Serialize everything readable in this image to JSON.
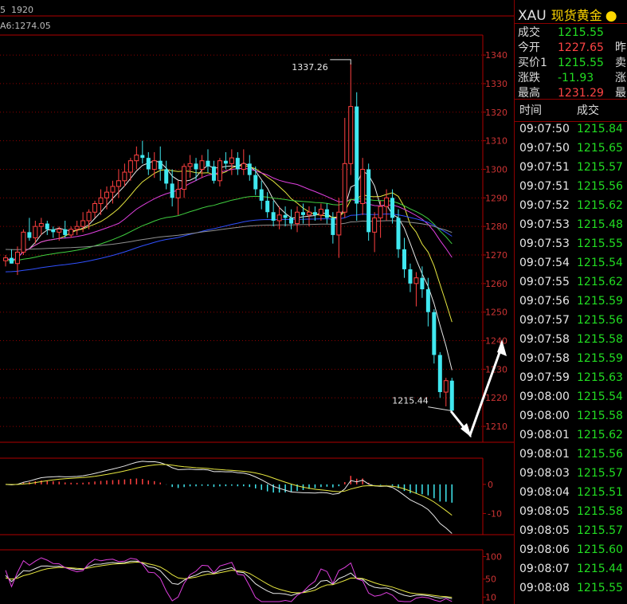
{
  "header": {
    "period": "5",
    "count": "1920",
    "ma_text": "A6:1274.05"
  },
  "chart_data": [
    {
      "type": "candlestick",
      "yticks": [
        1210,
        1220,
        1230,
        1240,
        1250,
        1260,
        1270,
        1280,
        1290,
        1300,
        1310,
        1320,
        1330,
        1340
      ],
      "ylim": [
        1205,
        1347
      ],
      "annotations": [
        {
          "label": "1337.26",
          "value": 1337.26
        },
        {
          "label": "1215.44",
          "value": 1215.44
        }
      ],
      "candles": [
        [
          1268,
          1270,
          1266,
          1269
        ],
        [
          1269,
          1272,
          1267,
          1267
        ],
        [
          1267,
          1273,
          1263,
          1271
        ],
        [
          1271,
          1279,
          1270,
          1278
        ],
        [
          1278,
          1283,
          1275,
          1276
        ],
        [
          1276,
          1282,
          1274,
          1280
        ],
        [
          1280,
          1283,
          1277,
          1281
        ],
        [
          1281,
          1282,
          1277,
          1279
        ],
        [
          1279,
          1280,
          1276,
          1278
        ],
        [
          1278,
          1280,
          1275,
          1279
        ],
        [
          1279,
          1282,
          1276,
          1277
        ],
        [
          1277,
          1280,
          1276,
          1279
        ],
        [
          1279,
          1282,
          1277,
          1280
        ],
        [
          1280,
          1285,
          1278,
          1282
        ],
        [
          1282,
          1286,
          1279,
          1285
        ],
        [
          1285,
          1289,
          1283,
          1288
        ],
        [
          1288,
          1293,
          1284,
          1290
        ],
        [
          1290,
          1294,
          1286,
          1292
        ],
        [
          1292,
          1296,
          1288,
          1294
        ],
        [
          1294,
          1300,
          1290,
          1296
        ],
        [
          1296,
          1302,
          1294,
          1299
        ],
        [
          1299,
          1304,
          1296,
          1303
        ],
        [
          1303,
          1308,
          1300,
          1305
        ],
        [
          1305,
          1310,
          1302,
          1304
        ],
        [
          1304,
          1306,
          1298,
          1300
        ],
        [
          1300,
          1306,
          1297,
          1303
        ],
        [
          1303,
          1308,
          1296,
          1300
        ],
        [
          1300,
          1303,
          1293,
          1295
        ],
        [
          1295,
          1300,
          1287,
          1290
        ],
        [
          1290,
          1296,
          1284,
          1293
        ],
        [
          1293,
          1302,
          1290,
          1301
        ],
        [
          1301,
          1305,
          1297,
          1302
        ],
        [
          1302,
          1304,
          1296,
          1300
        ],
        [
          1300,
          1305,
          1297,
          1303
        ],
        [
          1303,
          1307,
          1299,
          1301
        ],
        [
          1301,
          1303,
          1295,
          1296
        ],
        [
          1296,
          1304,
          1294,
          1303
        ],
        [
          1303,
          1306,
          1300,
          1302
        ],
        [
          1302,
          1307,
          1298,
          1304
        ],
        [
          1304,
          1306,
          1298,
          1300
        ],
        [
          1300,
          1307,
          1298,
          1302
        ],
        [
          1302,
          1305,
          1296,
          1298
        ],
        [
          1298,
          1301,
          1291,
          1293
        ],
        [
          1293,
          1296,
          1286,
          1289
        ],
        [
          1289,
          1292,
          1283,
          1285
        ],
        [
          1285,
          1289,
          1280,
          1282
        ],
        [
          1282,
          1287,
          1279,
          1284
        ],
        [
          1284,
          1287,
          1280,
          1283
        ],
        [
          1283,
          1286,
          1279,
          1281
        ],
        [
          1281,
          1287,
          1278,
          1285
        ],
        [
          1285,
          1288,
          1281,
          1284
        ],
        [
          1284,
          1287,
          1280,
          1285
        ],
        [
          1285,
          1287,
          1282,
          1284
        ],
        [
          1284,
          1288,
          1282,
          1286
        ],
        [
          1286,
          1288,
          1281,
          1283
        ],
        [
          1283,
          1285,
          1274,
          1277
        ],
        [
          1277,
          1290,
          1269,
          1285
        ],
        [
          1285,
          1318,
          1283,
          1302
        ],
        [
          1302,
          1337.26,
          1298,
          1322
        ],
        [
          1322,
          1327,
          1282,
          1288
        ],
        [
          1288,
          1304,
          1284,
          1300
        ],
        [
          1300,
          1302,
          1275,
          1278
        ],
        [
          1278,
          1285,
          1271,
          1283
        ],
        [
          1283,
          1289,
          1276,
          1287
        ],
        [
          1287,
          1293,
          1282,
          1290
        ],
        [
          1290,
          1293,
          1281,
          1283
        ],
        [
          1283,
          1286,
          1269,
          1272
        ],
        [
          1272,
          1276,
          1262,
          1265
        ],
        [
          1265,
          1267,
          1257,
          1260
        ],
        [
          1260,
          1264,
          1252,
          1262
        ],
        [
          1262,
          1266,
          1255,
          1258
        ],
        [
          1258,
          1262,
          1245,
          1250
        ],
        [
          1250,
          1251,
          1232,
          1235
        ],
        [
          1235,
          1236,
          1220,
          1222
        ],
        [
          1222,
          1227,
          1217,
          1226
        ],
        [
          1226,
          1227,
          1215.44,
          1215.5
        ]
      ]
    },
    {
      "type": "macd",
      "yticks": [
        0,
        -10
      ],
      "ylim": [
        -17,
        9
      ]
    },
    {
      "type": "oscillator",
      "yticks": [
        100,
        50,
        10
      ],
      "ylim": [
        0,
        115
      ]
    }
  ],
  "quote": {
    "symbol": "XAU",
    "name": "现货黄金",
    "dot": "●",
    "rows": [
      {
        "label": "成交",
        "value": "1215.55",
        "color": "#22dd22",
        "extra": ""
      },
      {
        "label": "今开",
        "value": "1227.65",
        "color": "#ff4444",
        "extra": "昨"
      },
      {
        "label": "买价1",
        "value": "1215.55",
        "color": "#22dd22",
        "extra": "卖"
      },
      {
        "label": "涨跌",
        "value": "-11.93",
        "color": "#22dd22",
        "extra": "涨"
      },
      {
        "label": "最高",
        "value": "1231.29",
        "color": "#ff4444",
        "extra": "最"
      }
    ]
  },
  "ticks": {
    "col_time": "时间",
    "col_price": "成交",
    "rows": [
      {
        "time": "09:07:50",
        "price": "1215.84"
      },
      {
        "time": "09:07:50",
        "price": "1215.65"
      },
      {
        "time": "09:07:51",
        "price": "1215.57"
      },
      {
        "time": "09:07:51",
        "price": "1215.56"
      },
      {
        "time": "09:07:52",
        "price": "1215.62"
      },
      {
        "time": "09:07:53",
        "price": "1215.48"
      },
      {
        "time": "09:07:53",
        "price": "1215.55"
      },
      {
        "time": "09:07:54",
        "price": "1215.54"
      },
      {
        "time": "09:07:55",
        "price": "1215.62"
      },
      {
        "time": "09:07:56",
        "price": "1215.59"
      },
      {
        "time": "09:07:57",
        "price": "1215.56"
      },
      {
        "time": "09:07:58",
        "price": "1215.58"
      },
      {
        "time": "09:07:58",
        "price": "1215.59"
      },
      {
        "time": "09:07:59",
        "price": "1215.63"
      },
      {
        "time": "09:08:00",
        "price": "1215.54"
      },
      {
        "time": "09:08:00",
        "price": "1215.58"
      },
      {
        "time": "09:08:01",
        "price": "1215.62"
      },
      {
        "time": "09:08:01",
        "price": "1215.56"
      },
      {
        "time": "09:08:03",
        "price": "1215.57"
      },
      {
        "time": "09:08:04",
        "price": "1215.51"
      },
      {
        "time": "09:08:05",
        "price": "1215.58"
      },
      {
        "time": "09:08:05",
        "price": "1215.57"
      },
      {
        "time": "09:08:06",
        "price": "1215.60"
      },
      {
        "time": "09:08:07",
        "price": "1215.44"
      },
      {
        "time": "09:08:08",
        "price": "1215.55"
      }
    ],
    "price_color": "#22dd22"
  },
  "colors": {
    "up": "#ff4040",
    "down": "#40e8f0",
    "axis": "#b00000",
    "label": "#cc3333",
    "ma_white": "#e8e8e8",
    "ma_yellow": "#e8e840",
    "ma_magenta": "#e040e0",
    "ma_green": "#40d040",
    "ma_blue": "#3050ff",
    "ma_gray": "#909090"
  }
}
